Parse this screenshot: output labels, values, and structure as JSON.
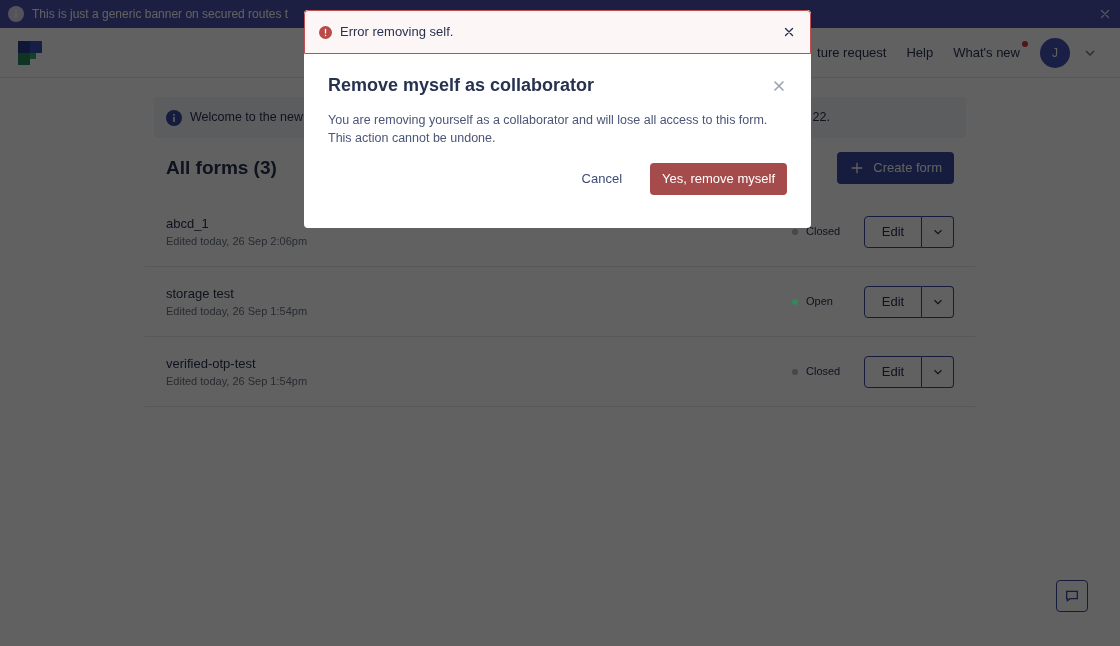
{
  "banner": {
    "text": "This is just a generic banner on secured routes t"
  },
  "header": {
    "nav": [
      {
        "label": "ture request",
        "unread": false
      },
      {
        "label": "Help",
        "unread": false
      },
      {
        "label": "What's new",
        "unread": true
      }
    ],
    "avatar": {
      "initial": "J"
    }
  },
  "welcome": {
    "text_start": "Welcome to the new",
    "text_end": "22."
  },
  "forms": {
    "title": "All forms (3)",
    "create_button": "Create form",
    "rows": [
      {
        "name": "abcd_1",
        "edited": "Edited today, 26 Sep 2:06pm",
        "status": "Closed",
        "color": "#474747",
        "edit_label": "Edit"
      },
      {
        "name": "storage test",
        "edited": "Edited today, 26 Sep 1:54pm",
        "status": "Open",
        "color": "#2f8a5e",
        "edit_label": "Edit"
      },
      {
        "name": "verified-otp-test",
        "edited": "Edited today, 26 Sep 1:54pm",
        "status": "Closed",
        "color": "#474747",
        "edit_label": "Edit"
      }
    ]
  },
  "toast": {
    "kind": "error",
    "text": "Error removing self."
  },
  "modal": {
    "title": "Remove myself as collaborator",
    "body": "You are removing yourself as a collaborator and will lose all access to this form. This action cannot be undone.",
    "cancel": "Cancel",
    "confirm": "Yes, remove myself"
  }
}
